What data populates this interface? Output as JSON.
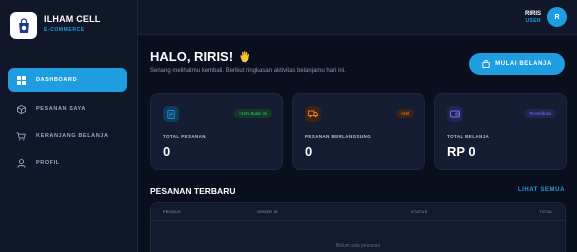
{
  "brand": {
    "name": "ILHAM CELL",
    "subtitle": "E-COMMERCE"
  },
  "nav": {
    "items": [
      {
        "label": "DASHBOARD",
        "icon": "dashboard-grid-icon",
        "active": true
      },
      {
        "label": "PESANAN SAYA",
        "icon": "box-icon",
        "active": false
      },
      {
        "label": "KERANJANG BELANJA",
        "icon": "cart-icon",
        "active": false
      },
      {
        "label": "PROFIL",
        "icon": "user-icon",
        "active": false
      }
    ]
  },
  "user": {
    "name": "RIRIS",
    "role": "USER",
    "initial": "R"
  },
  "header": {
    "greeting": "HALO, RIRIS!",
    "subtitle": "Senang melihatmu kembali. Berikut ringkasan aktivitas belanjamu hari ini.",
    "cta_label": "MULAI BELANJA"
  },
  "stats": [
    {
      "label": "TOTAL PESANAN",
      "value": "0",
      "badge": "+12% Bulan Ini",
      "icon": "receipt-icon"
    },
    {
      "label": "PESANAN BERLANGSUNG",
      "value": "0",
      "badge": "Aktif",
      "icon": "truck-icon"
    },
    {
      "label": "TOTAL BELANJA",
      "value": "RP 0",
      "badge": "Terverifikasi",
      "icon": "wallet-icon"
    }
  ],
  "orders": {
    "title": "PESANAN TERBARU",
    "link": "LIHAT SEMUA",
    "columns": [
      "PRODUK",
      "ORDER ID",
      "STATUS",
      "TOTAL"
    ],
    "empty": "Belum ada pesanan"
  },
  "colors": {
    "accent": "#1e9ee0",
    "background": "#0a0f1e",
    "sidebar": "#0f1729",
    "card": "#141d31",
    "badge_green": "#2ecc71",
    "badge_orange": "#f5822a",
    "badge_purple": "#7b74ff"
  }
}
